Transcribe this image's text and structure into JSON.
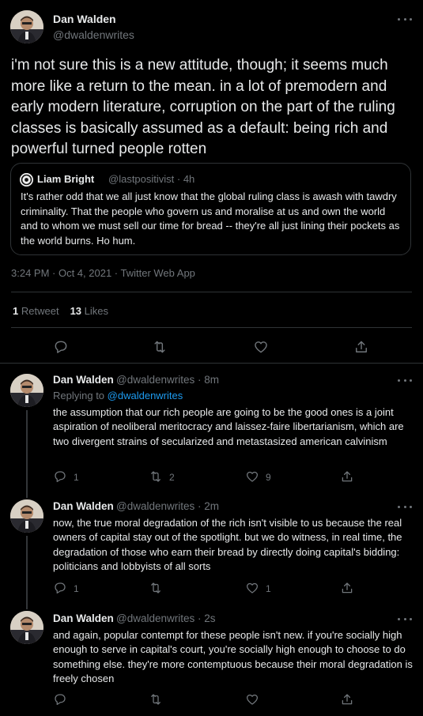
{
  "main_tweet": {
    "author_name": "Dan Walden",
    "author_handle": "@dwaldenwrites",
    "text": "i'm not sure this is a new attitude, though; it seems much more like a return to the mean. in a lot of premodern and early modern literature, corruption on the part of the ruling classes is basically assumed as a default: being rich and powerful turned people rotten",
    "quote": {
      "author_name": "Liam Bright",
      "author_meta": "@lastpositivist · 4h",
      "text": "It's rather odd that we all just know that the global ruling class is awash with tawdry criminality. That the people who govern us and moralise at us and own the world and to whom we must sell our time for bread -- they're all just lining their pockets as the world burns. Ho hum."
    },
    "timestamp": "3:24 PM · Oct 4, 2021 · Twitter Web App",
    "retweets_count": "1",
    "retweets_label": "Retweet",
    "likes_count": "13",
    "likes_label": "Likes",
    "icons": [
      "reply-icon",
      "retweet-icon",
      "like-icon",
      "share-icon",
      "more-icon"
    ]
  },
  "replies": [
    {
      "author_name": "Dan Walden",
      "author_handle": "@dwaldenwrites · 8m",
      "replying_prefix": "Replying to",
      "replying_handle": "@dwaldenwrites",
      "text": "the assumption that our rich people are going to be the good ones is a joint aspiration of neoliberal meritocracy and laissez-faire libertarianism, which are two divergent strains of secularized and metastasized american calvinism",
      "reply_count": "1",
      "retweet_count": "2",
      "like_count": "9"
    },
    {
      "author_name": "Dan Walden",
      "author_handle": "@dwaldenwrites · 2m",
      "text": "now, the true moral degradation of the rich isn't visible to us because the real owners of capital stay out of the spotlight. but we do witness, in real time, the degradation of those who earn their bread by directly doing capital's bidding: politicians and lobbyists of all sorts",
      "reply_count": "1",
      "retweet_count": "",
      "like_count": "1"
    },
    {
      "author_name": "Dan Walden",
      "author_handle": "@dwaldenwrites · 2s",
      "text": "and again, popular contempt for these people isn't new. if you're socially high enough to serve in capital's court, you're socially high enough to choose to do something else. they're more contemptuous because their moral degradation is freely chosen",
      "reply_count": "",
      "retweet_count": "",
      "like_count": ""
    }
  ],
  "colors": {
    "background": "#000000",
    "text": "#e7e9ea",
    "secondary": "#71767b",
    "link": "#1d9bf0",
    "border": "#2f3336"
  }
}
